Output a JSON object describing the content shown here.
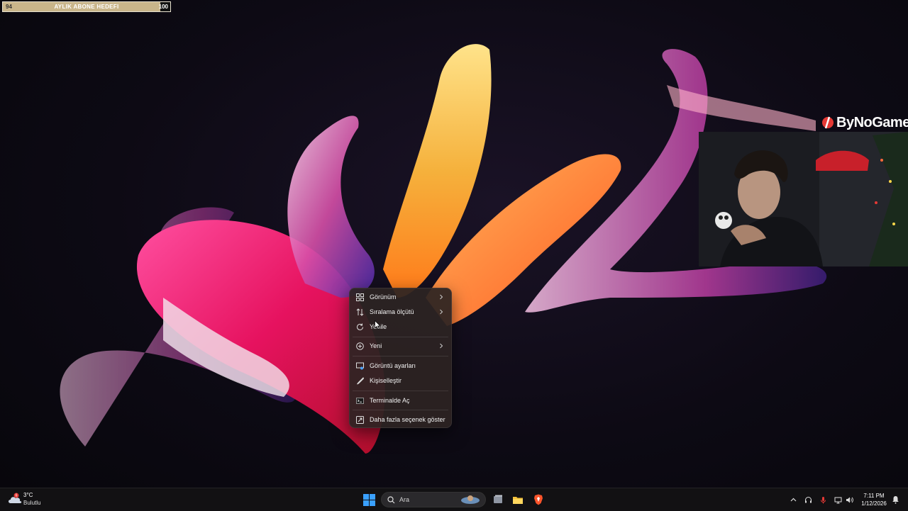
{
  "overlay": {
    "goal": {
      "title": "AYLIK ABONE HEDEFI",
      "current": "94",
      "max": "100",
      "progress": 0.94
    },
    "sponsor": "ByNoGame",
    "webcam_icon": "webcam-feed"
  },
  "context_menu": {
    "items": [
      {
        "label": "Görünüm",
        "icon": "grid-icon",
        "submenu": true
      },
      {
        "label": "Sıralama ölçütü",
        "icon": "sort-icon",
        "submenu": true
      },
      {
        "label": "Yenile",
        "icon": "refresh-icon",
        "submenu": false
      },
      {
        "label": "Yeni",
        "icon": "plus-circle-icon",
        "submenu": true
      },
      {
        "label": "Görüntü ayarları",
        "icon": "display-icon",
        "submenu": false
      },
      {
        "label": "Kişiselleştir",
        "icon": "brush-icon",
        "submenu": false
      },
      {
        "label": "Terminalde Aç",
        "icon": "terminal-icon",
        "submenu": false
      },
      {
        "label": "Daha fazla seçenek göster",
        "icon": "more-options-icon",
        "submenu": false
      }
    ]
  },
  "taskbar": {
    "weather": {
      "temp": "3°C",
      "condition": "Bulutlu",
      "badge": "6"
    },
    "search": {
      "placeholder": "Ara"
    },
    "apps": [
      "start-icon",
      "task-view-icon",
      "file-explorer-icon",
      "brave-browser-icon"
    ],
    "tray": [
      "chevron-up-icon",
      "headset-icon",
      "microphone-icon",
      "network-icon",
      "volume-icon"
    ],
    "clock": {
      "time": "7:11 PM",
      "date": "1/12/2026"
    }
  },
  "colors": {
    "accent": "#e91e63",
    "menu_bg": "#2c2422",
    "taskbar_bg": "#121113",
    "goal_fill": "#c9b58a"
  }
}
